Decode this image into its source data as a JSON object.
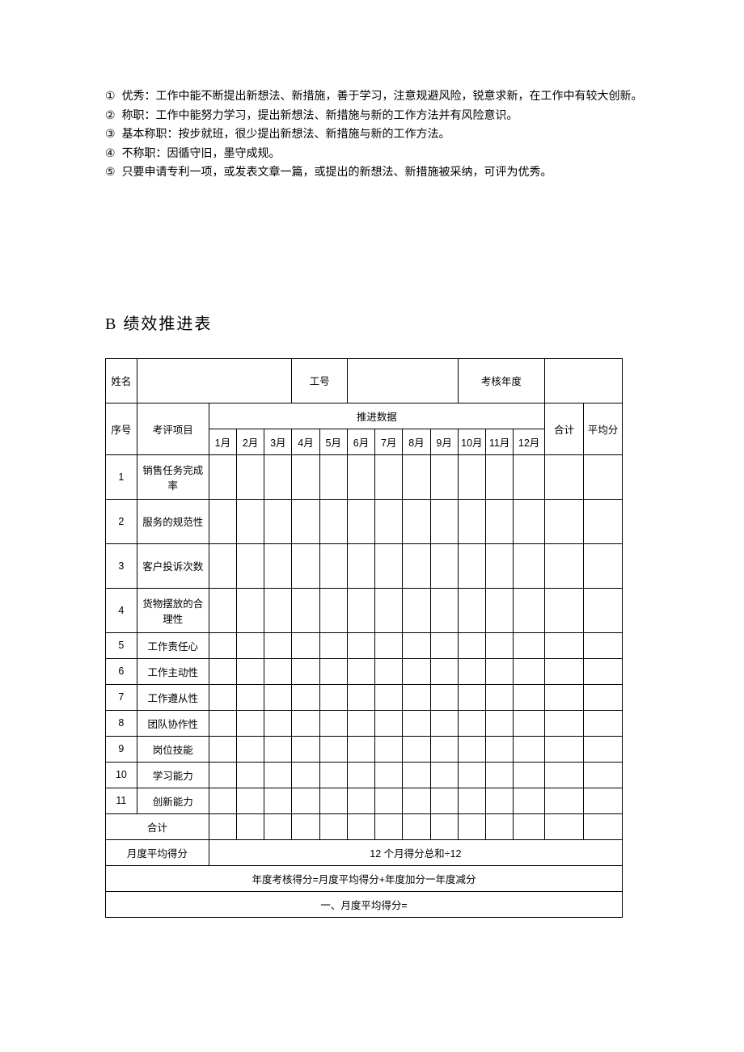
{
  "criteria": {
    "items": [
      {
        "marker": "①",
        "text": "优秀：工作中能不断提出新想法、新措施，善于学习，注意规避风险，锐意求新，在工作中有较大创新。"
      },
      {
        "marker": "②",
        "text": "称职：工作中能努力学习，提出新想法、新措施与新的工作方法并有风险意识。"
      },
      {
        "marker": "③",
        "text": "基本称职：按步就班，很少提出新想法、新措施与新的工作方法。"
      },
      {
        "marker": "④",
        "text": "不称职：因循守旧，墨守成规。"
      },
      {
        "marker": "⑤",
        "text": "只要申请专利一项，或发表文章一篇，或提出的新想法、新措施被采纳，可评为优秀。"
      }
    ]
  },
  "section_title": "B 绩效推进表",
  "header": {
    "name_label": "姓名",
    "job_no_label": "工号",
    "year_label": "考核年度"
  },
  "table": {
    "seq_label": "序号",
    "item_label": "考评项目",
    "push_label": "推进数据",
    "total_label": "合计",
    "avg_label": "平均分",
    "months": [
      "1月",
      "2月",
      "3月",
      "4月",
      "5月",
      "6月",
      "7月",
      "8月",
      "9月",
      "10月",
      "11月",
      "12月"
    ],
    "rows": [
      {
        "no": "1",
        "name": "销售任务完成率"
      },
      {
        "no": "2",
        "name": "服务的规范性"
      },
      {
        "no": "3",
        "name": "客户投诉次数"
      },
      {
        "no": "4",
        "name": "货物摆放的合理性"
      },
      {
        "no": "5",
        "name": "工作责任心"
      },
      {
        "no": "6",
        "name": "工作主动性"
      },
      {
        "no": "7",
        "name": "工作遵从性"
      },
      {
        "no": "8",
        "name": "团队协作性"
      },
      {
        "no": "9",
        "name": "岗位技能"
      },
      {
        "no": "10",
        "name": "学习能力"
      },
      {
        "no": "11",
        "name": "创新能力"
      }
    ],
    "sum_label": "合计",
    "month_avg_label": "月度平均得分",
    "month_avg_formula": "12 个月得分总和÷12",
    "annual_formula": "年度考核得分=月度平均得分+年度加分一年度减分",
    "footer_line": "一、月度平均得分="
  }
}
